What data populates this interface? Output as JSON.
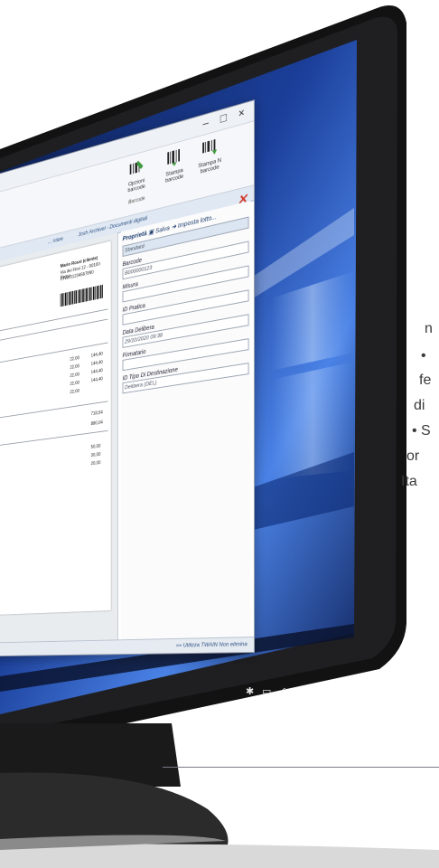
{
  "window": {
    "minimize": "–",
    "maximize": "□",
    "close": "×"
  },
  "ribbon": {
    "buttons": [
      {
        "label": "Opzioni barcode"
      },
      {
        "label": "Stampa barcode"
      },
      {
        "label": "Stampa N barcode"
      }
    ],
    "group_suffix": "Barcode"
  },
  "tabs": {
    "items": [
      "... ntare",
      "Josh Archivel - Documenti digitali"
    ]
  },
  "properties": {
    "header": "Proprietà",
    "save": "Salva",
    "set_lot": "Imposta lotto...",
    "fields": [
      {
        "label": "",
        "value": "Standard"
      },
      {
        "label": "Barcode",
        "value": "B000000123"
      },
      {
        "label": "Misura",
        "value": ""
      },
      {
        "label": "ID Pratica",
        "value": ""
      },
      {
        "label": "Data Delibera",
        "value": "29/10/2020 09:38"
      },
      {
        "label": "Firmatario",
        "value": ""
      },
      {
        "label": "ID Tipo Di Destinazione",
        "value": "Delibera (DEL)"
      }
    ]
  },
  "status": {
    "text": "»» Utilizza TWAIN   Non elimina"
  },
  "document": {
    "header_lines": [
      "Mario Rossi (cliente)",
      "Via dei Fiori 12 - 00100 Roma",
      "P.IVA 01234567890"
    ],
    "amounts": [
      "22,00",
      "22,00",
      "22,00",
      "22,00",
      "22,00"
    ],
    "totals": [
      "144,40",
      "144,40",
      "144,40",
      "144,40"
    ],
    "summary": [
      "718,54",
      "880,04"
    ],
    "payments": [
      "50,00",
      "30,00",
      "20,00"
    ]
  },
  "sidetext": [
    "n",
    "•",
    "fe",
    "di",
    "• S",
    "or",
    "Ita"
  ],
  "colors": {
    "bezel": "#141414",
    "screen_glow": "#3b6fd8",
    "accent_blue": "#1d3d6e"
  }
}
